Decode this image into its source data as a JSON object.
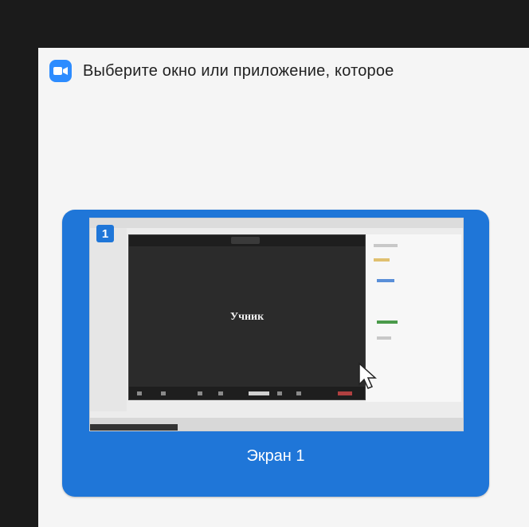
{
  "dialog": {
    "title": "Выберите окно или приложение, которое",
    "app_icon": "camera-icon",
    "accent": "#2d8cff"
  },
  "screens": [
    {
      "label": "Экран 1",
      "number": "1",
      "thumbnail_name_text": "Учник",
      "selected": true,
      "card_color": "#1f76d8"
    }
  ]
}
